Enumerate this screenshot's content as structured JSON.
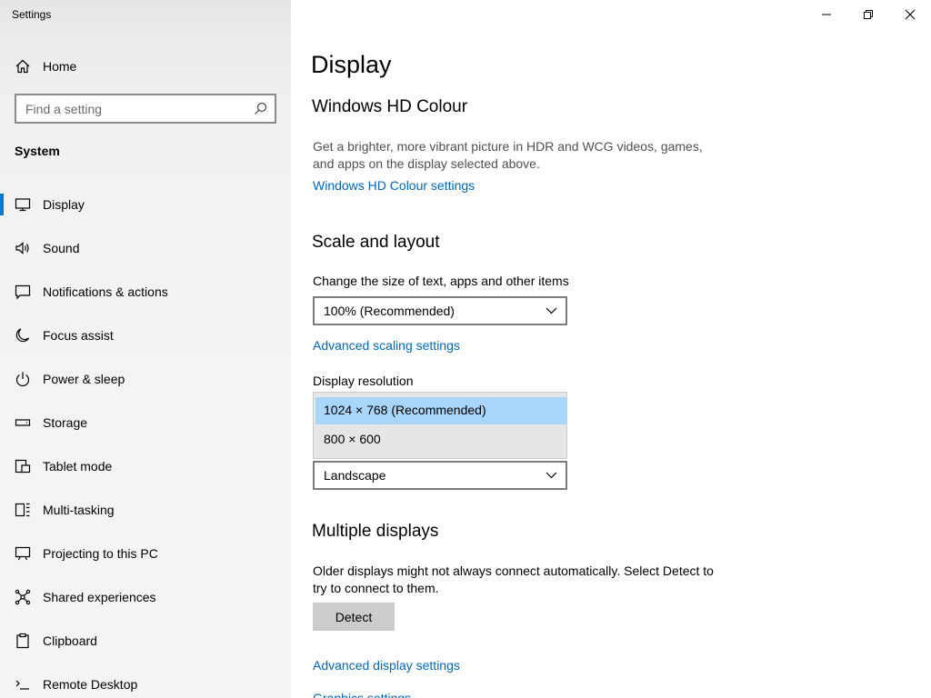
{
  "window": {
    "title": "Settings"
  },
  "sidebar": {
    "home_label": "Home",
    "search_placeholder": "Find a setting",
    "section_label": "System",
    "items": [
      {
        "label": "Display",
        "icon": "monitor-icon",
        "active": true
      },
      {
        "label": "Sound",
        "icon": "speaker-icon"
      },
      {
        "label": "Notifications & actions",
        "icon": "notification-icon"
      },
      {
        "label": "Focus assist",
        "icon": "moon-icon"
      },
      {
        "label": "Power & sleep",
        "icon": "power-icon"
      },
      {
        "label": "Storage",
        "icon": "storage-icon"
      },
      {
        "label": "Tablet mode",
        "icon": "tablet-icon"
      },
      {
        "label": "Multi-tasking",
        "icon": "multitasking-icon"
      },
      {
        "label": "Projecting to this PC",
        "icon": "projector-icon"
      },
      {
        "label": "Shared experiences",
        "icon": "shared-icon"
      },
      {
        "label": "Clipboard",
        "icon": "clipboard-icon"
      },
      {
        "label": "Remote Desktop",
        "icon": "remote-desktop-icon"
      }
    ]
  },
  "main": {
    "title": "Display",
    "hd_colour": {
      "heading": "Windows HD Colour",
      "description_line1": "Get a brighter, more vibrant picture in HDR and WCG videos, games,",
      "description_line2": "and apps on the display selected above.",
      "link": "Windows HD Colour settings"
    },
    "scale": {
      "heading": "Scale and layout",
      "size_label": "Change the size of text, apps and other items",
      "size_value": "100% (Recommended)",
      "advanced_link": "Advanced scaling settings",
      "resolution_label": "Display resolution",
      "resolution_options": [
        "1024 × 768 (Recommended)",
        "800 × 600"
      ],
      "selected_resolution": "1024 × 768 (Recommended)",
      "orientation_value": "Landscape"
    },
    "multiple": {
      "heading": "Multiple displays",
      "description_line1": "Older displays might not always connect automatically. Select Detect to",
      "description_line2": "try to connect to them.",
      "detect_button": "Detect",
      "advanced_link": "Advanced display settings",
      "graphics_link": "Graphics settings"
    }
  },
  "colors": {
    "accent": "#0078d7",
    "link": "#0067b8",
    "selection": "#a8d5fb"
  }
}
